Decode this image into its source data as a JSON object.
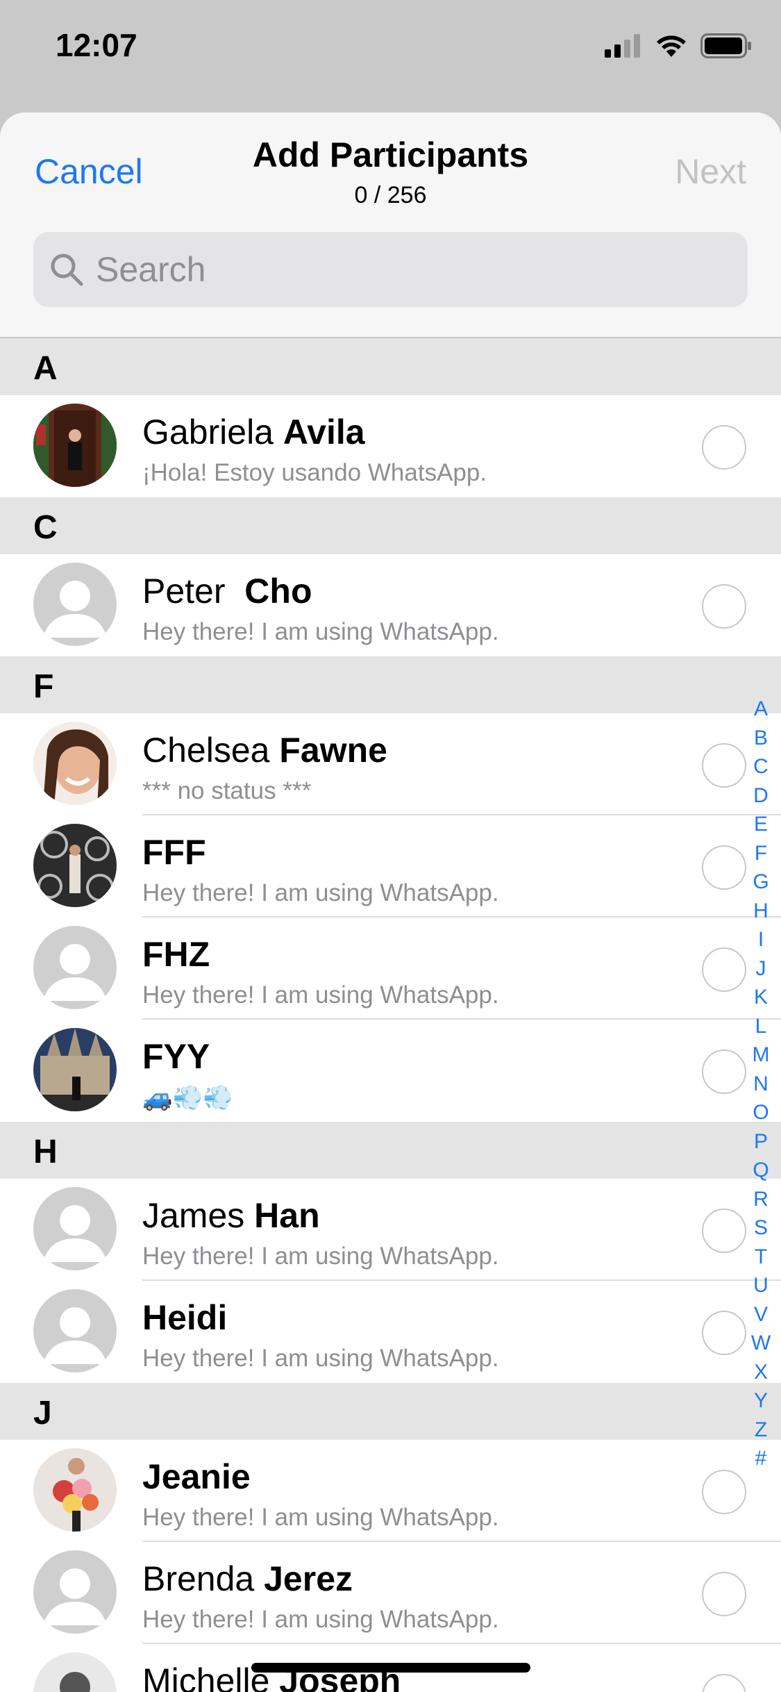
{
  "status_bar": {
    "time": "12:07"
  },
  "header": {
    "cancel_label": "Cancel",
    "title": "Add Participants",
    "count": "0 / 256",
    "next_label": "Next",
    "search_placeholder": "Search"
  },
  "sections": [
    {
      "letter": "A",
      "contacts": [
        {
          "first": "Gabriela ",
          "last": "Avila",
          "status": "¡Hola! Estoy usando WhatsApp.",
          "avatar": "photo-door"
        }
      ]
    },
    {
      "letter": "C",
      "contacts": [
        {
          "first": "Peter  ",
          "last": "Cho",
          "status": "Hey there! I am using WhatsApp.",
          "avatar": "default"
        }
      ]
    },
    {
      "letter": "F",
      "contacts": [
        {
          "first": "Chelsea ",
          "last": "Fawne",
          "status": "*** no status ***",
          "avatar": "photo-face"
        },
        {
          "first": "",
          "last": "FFF",
          "status": "Hey there! I am using WhatsApp.",
          "avatar": "photo-floral"
        },
        {
          "first": "",
          "last": "FHZ",
          "status": "Hey there! I am using WhatsApp.",
          "avatar": "default"
        },
        {
          "first": "",
          "last": "FYY",
          "status": "🚙💨💨",
          "avatar": "photo-cathedral"
        }
      ]
    },
    {
      "letter": "H",
      "contacts": [
        {
          "first": "James ",
          "last": "Han",
          "status": "Hey there! I am using WhatsApp.",
          "avatar": "default"
        },
        {
          "first": "",
          "last": "Heidi",
          "status": "Hey there! I am using WhatsApp.",
          "avatar": "default"
        }
      ]
    },
    {
      "letter": "J",
      "contacts": [
        {
          "first": "",
          "last": "Jeanie",
          "status": "Hey there! I am using WhatsApp.",
          "avatar": "photo-flowers"
        },
        {
          "first": "Brenda ",
          "last": "Jerez",
          "status": "Hey there! I am using WhatsApp.",
          "avatar": "default"
        },
        {
          "first": "Michelle ",
          "last": "Joseph",
          "status": "",
          "avatar": "photo-bw"
        }
      ]
    }
  ],
  "index_letters": [
    "A",
    "B",
    "C",
    "D",
    "E",
    "F",
    "G",
    "H",
    "I",
    "J",
    "K",
    "L",
    "M",
    "N",
    "O",
    "P",
    "Q",
    "R",
    "S",
    "T",
    "U",
    "V",
    "W",
    "X",
    "Y",
    "Z",
    "#"
  ],
  "colors": {
    "accent": "#1e78f0",
    "disabled": "#c2c2c2",
    "secondary_text": "#8e8e93"
  }
}
